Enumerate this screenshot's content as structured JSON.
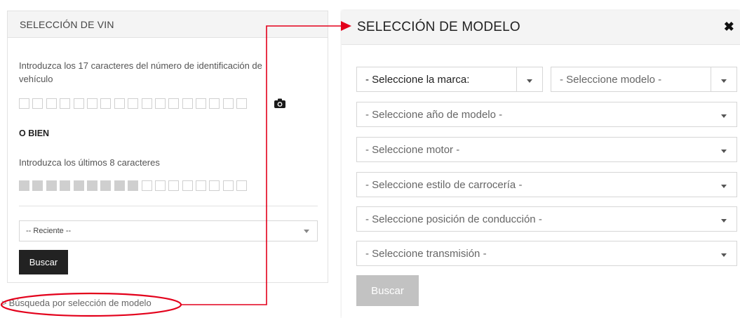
{
  "vin_panel": {
    "title": "SELECCIÓN DE VIN",
    "instruction_full": "Introduzca los 17 caracteres del número de identificación de vehículo",
    "or_label": "O BIEN",
    "instruction_last8": "Introduzca los últimos 8 caracteres",
    "vin_box_count": 17,
    "last8_filled_count": 9,
    "recent_select_value": "-- Reciente --",
    "search_button": "Buscar",
    "camera_icon": "camera-icon"
  },
  "model_link": {
    "label": "Búsqueda por selección de modelo",
    "chevron": ">"
  },
  "model_panel": {
    "title": "SELECCIÓN DE MODELO",
    "close_icon": "close-icon",
    "brand_select": "- Seleccione la marca:",
    "model_select": "- Seleccione modelo -",
    "year_select": "- Seleccione año de modelo -",
    "engine_select": "- Seleccione motor -",
    "body_select": "- Seleccione estilo de carrocería -",
    "drive_select": "- Seleccione posición de conducción -",
    "transmission_select": "- Seleccione transmisión -",
    "search_button": "Buscar"
  },
  "colors": {
    "annotation": "#e3001b",
    "dark_button": "#222222",
    "disabled_button": "#c2c2c2",
    "header_bg": "#f4f4f4"
  }
}
